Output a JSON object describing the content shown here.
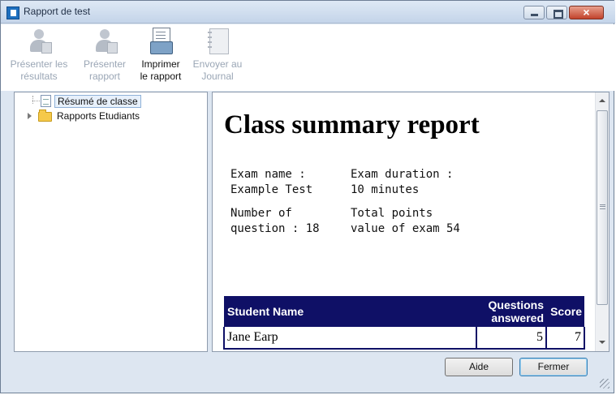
{
  "window": {
    "title": "Rapport de test"
  },
  "toolbar": {
    "present_results": {
      "line1": "Présenter les",
      "line2": "résultats",
      "icon": "student-results-icon"
    },
    "present_report": {
      "line1": "Présenter",
      "line2": "rapport",
      "icon": "student-report-icon"
    },
    "print_report": {
      "line1": "Imprimer",
      "line2": "le rapport",
      "icon": "printer-icon"
    },
    "send_journal": {
      "line1": "Envoyer au",
      "line2": "Journal",
      "icon": "journal-icon"
    }
  },
  "tree": {
    "items": [
      {
        "label": "Résumé de classe",
        "icon": "document-icon",
        "selected": true
      },
      {
        "label": "Rapports Etudiants",
        "icon": "folder-icon",
        "expandable": true
      }
    ]
  },
  "report": {
    "title": "Class summary report",
    "exam_name_label": "Exam name :",
    "exam_name_value": "Example Test",
    "exam_duration_label": "Exam duration :",
    "exam_duration_value": "10 minutes",
    "num_questions_line1": "Number of",
    "num_questions_line2": "question : 18",
    "total_points_line1": "Total points",
    "total_points_line2": "value of exam 54",
    "table": {
      "headers": {
        "name": "Student Name",
        "questions_line1": "Questions",
        "questions_line2": "answered",
        "score": "Score"
      },
      "rows": [
        {
          "name": "Jane Earp",
          "questions": "5",
          "score": "7"
        }
      ]
    }
  },
  "buttons": {
    "help": "Aide",
    "close": "Fermer"
  },
  "colors": {
    "table_header": "#0f1066",
    "titlebar": "#c4d4e9",
    "close_button": "#c2432b"
  }
}
